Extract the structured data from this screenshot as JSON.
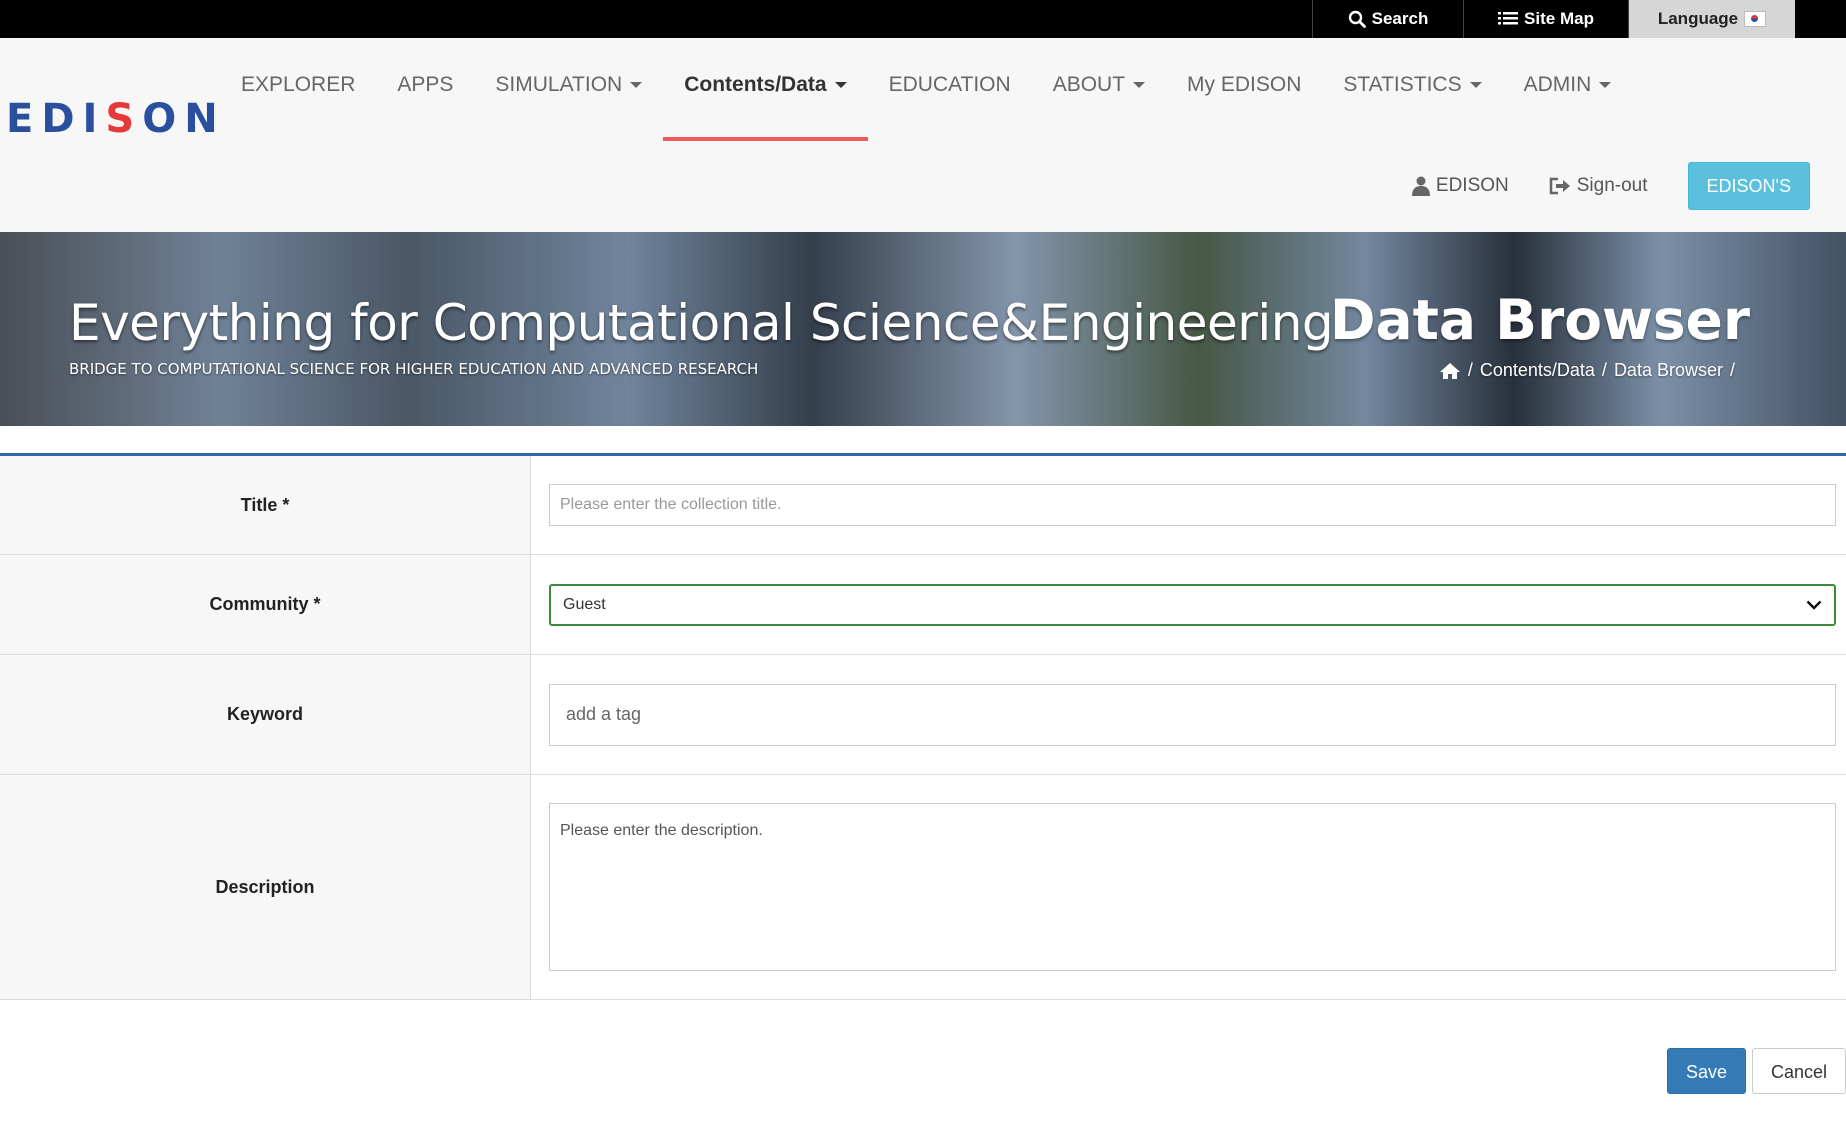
{
  "topbar": {
    "search": "Search",
    "sitemap": "Site Map",
    "language": "Language"
  },
  "logo": {
    "text_pre": "EDI",
    "text_s": "S",
    "text_post": "ON"
  },
  "nav": {
    "items": [
      {
        "label": "EXPLORER"
      },
      {
        "label": "APPS"
      },
      {
        "label": "SIMULATION"
      },
      {
        "label": "Contents/Data"
      },
      {
        "label": "EDUCATION"
      },
      {
        "label": "ABOUT"
      },
      {
        "label": "My EDISON"
      },
      {
        "label": "STATISTICS"
      },
      {
        "label": "ADMIN"
      }
    ],
    "active": "Contents/Data"
  },
  "user": {
    "name": "EDISON",
    "signout": "Sign-out",
    "edisons_button": "EDISON'S"
  },
  "banner": {
    "title": "Everything for Computational Science&Engineering",
    "subtitle": "BRIDGE TO COMPUTATIONAL SCIENCE FOR HIGHER EDUCATION AND ADVANCED RESEARCH",
    "page_title": "Data Browser",
    "breadcrumb": [
      "Contents/Data",
      "Data Browser"
    ]
  },
  "form": {
    "title_label": "Title *",
    "title_placeholder": "Please enter the collection title.",
    "community_label": "Community *",
    "community_value": "Guest",
    "keyword_label": "Keyword",
    "keyword_placeholder": "add a tag",
    "description_label": "Description",
    "description_placeholder": "Please enter the description."
  },
  "actions": {
    "save": "Save",
    "cancel": "Cancel"
  },
  "colors": {
    "accent": "#f05a5a",
    "primary": "#337ab7",
    "info": "#5bc0de",
    "select_border": "#3c8a3c",
    "form_top_border": "#2b6ca8"
  },
  "icons": [
    "search-icon",
    "list-icon",
    "korea-flag-icon",
    "user-icon",
    "sign-out-icon",
    "home-icon",
    "chevron-down-icon"
  ]
}
